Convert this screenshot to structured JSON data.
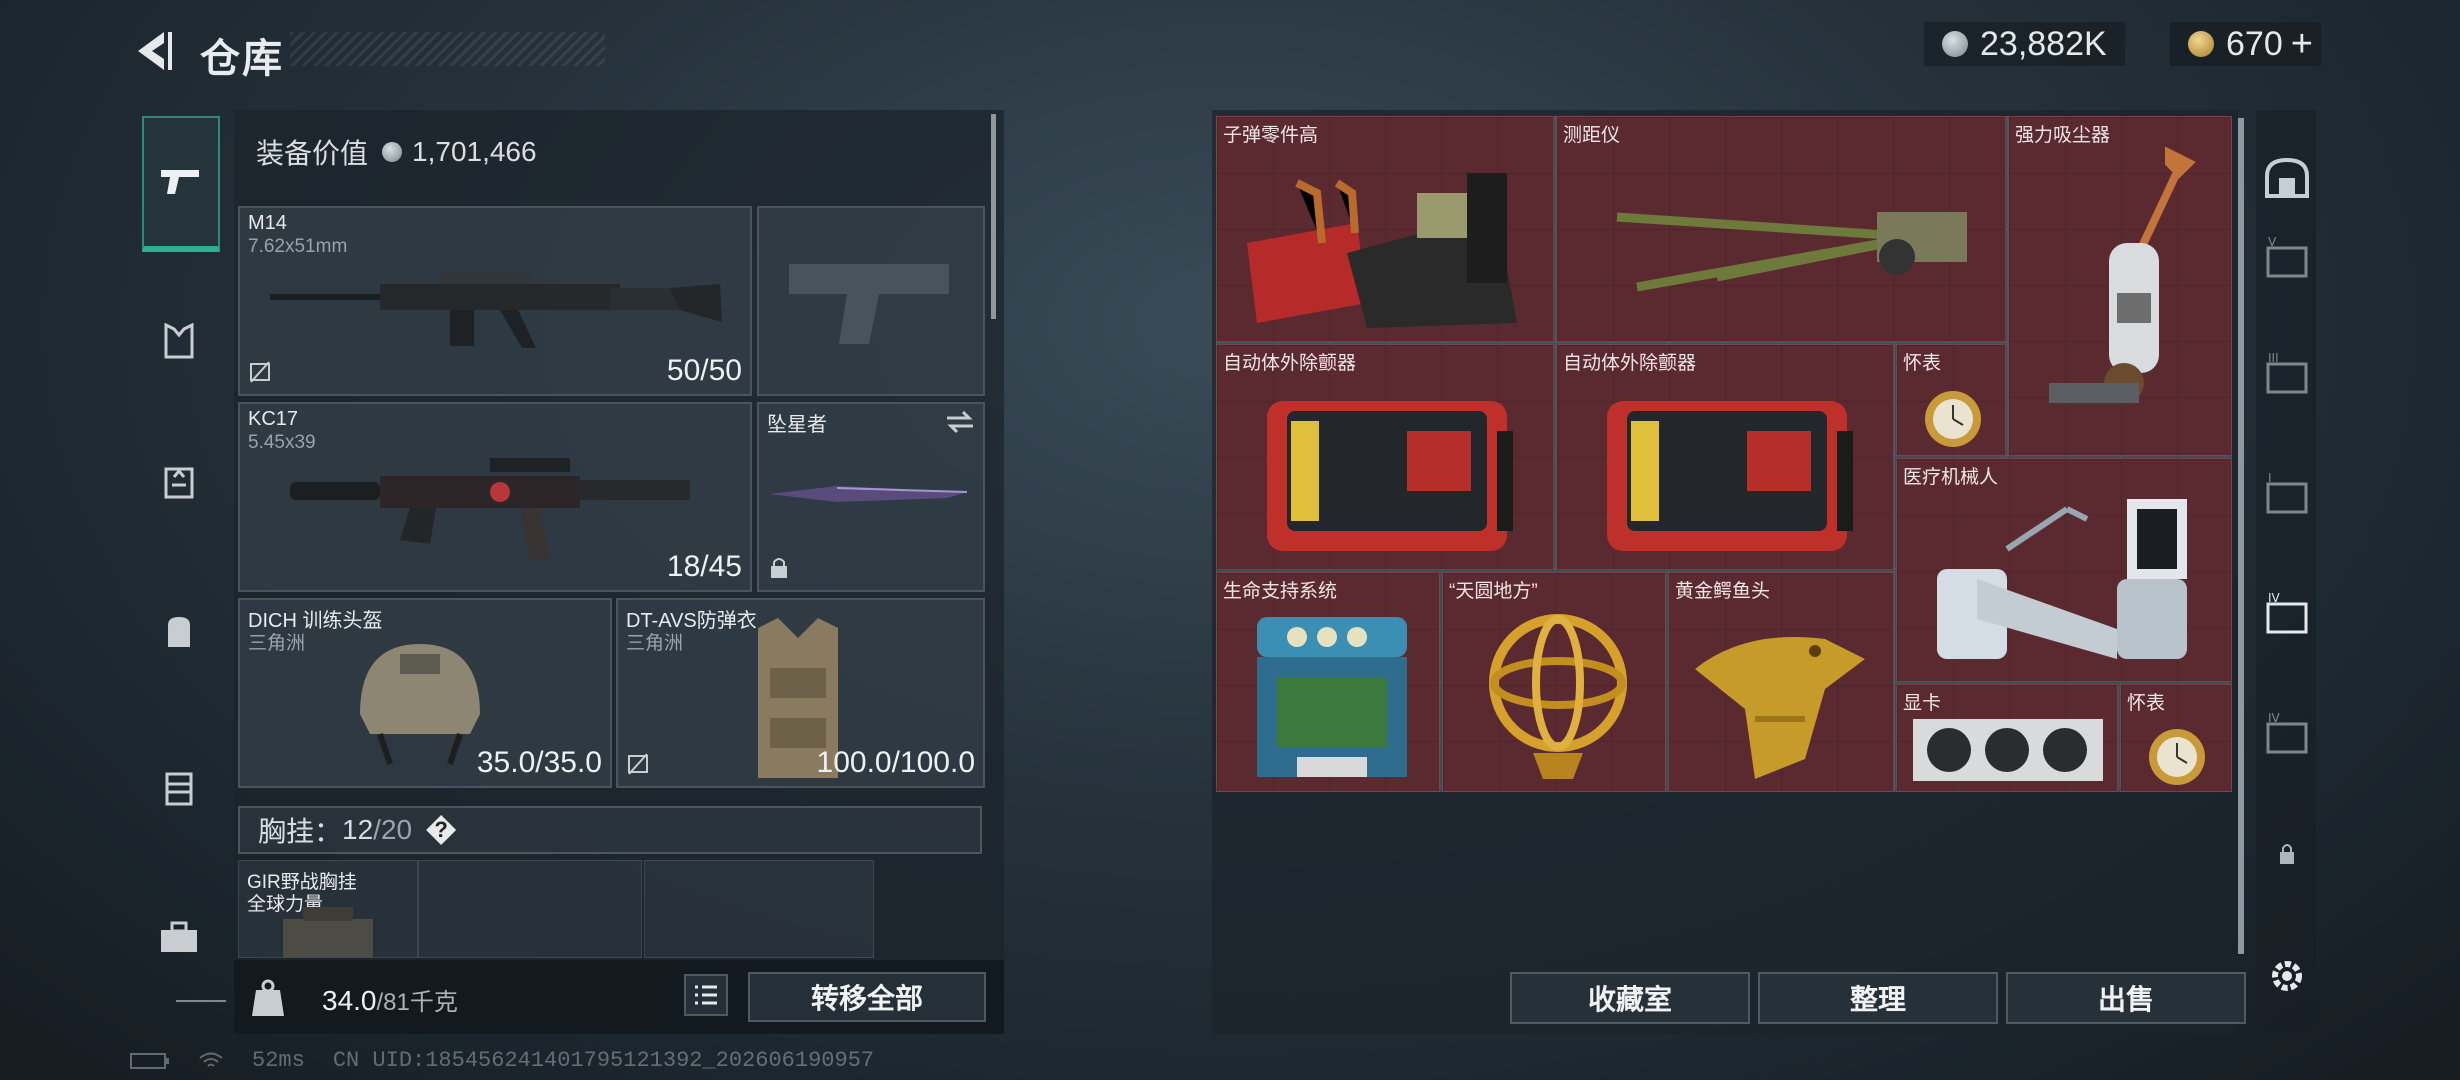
{
  "header": {
    "title": "仓库",
    "currency_silver": "23,882K",
    "currency_gold": "670",
    "currency_plus": "+"
  },
  "equipment": {
    "value_label": "装备价值",
    "value": "1,701,466",
    "cards": [
      {
        "name": "M14",
        "sub": "7.62x51mm",
        "count": "50/50"
      },
      {
        "name": "KC17",
        "sub": "5.45x39",
        "count": "18/45"
      },
      {
        "name": "坠星者",
        "sub": "",
        "count": ""
      },
      {
        "name": "DICH 训练头盔",
        "sub": "三角洲",
        "count": "35.0/35.0"
      },
      {
        "name": "DT-AVS防弹衣",
        "sub": "三角洲",
        "count": "100.0/100.0"
      }
    ],
    "chest_label": "胸挂：",
    "chest_used": "12",
    "chest_total": "/20",
    "chest_item": {
      "name": "GIR野战胸挂",
      "sub": "全球力量"
    },
    "weight_current": "34.0",
    "weight_max": "/81千克",
    "transfer_all": "转移全部"
  },
  "storage": {
    "items": [
      {
        "label": "子弹零件高"
      },
      {
        "label": "测距仪"
      },
      {
        "label": "强力吸尘器"
      },
      {
        "label": "自动体外除颤器"
      },
      {
        "label": "自动体外除颤器"
      },
      {
        "label": "怀表"
      },
      {
        "label": "医疗机械人"
      },
      {
        "label": "生命支持系统"
      },
      {
        "label": "“天圆地方”"
      },
      {
        "label": "黄金鳄鱼头"
      },
      {
        "label": "显卡"
      },
      {
        "label": "怀表"
      }
    ],
    "buttons": {
      "collection": "收藏室",
      "organize": "整理",
      "sell": "出售"
    }
  },
  "footer": {
    "ping": "52ms",
    "uid": "CN UID:18545624140179512139​2_202606190957"
  },
  "colors": {
    "accent": "#2fae96",
    "item_bg": "#5b2a31"
  }
}
